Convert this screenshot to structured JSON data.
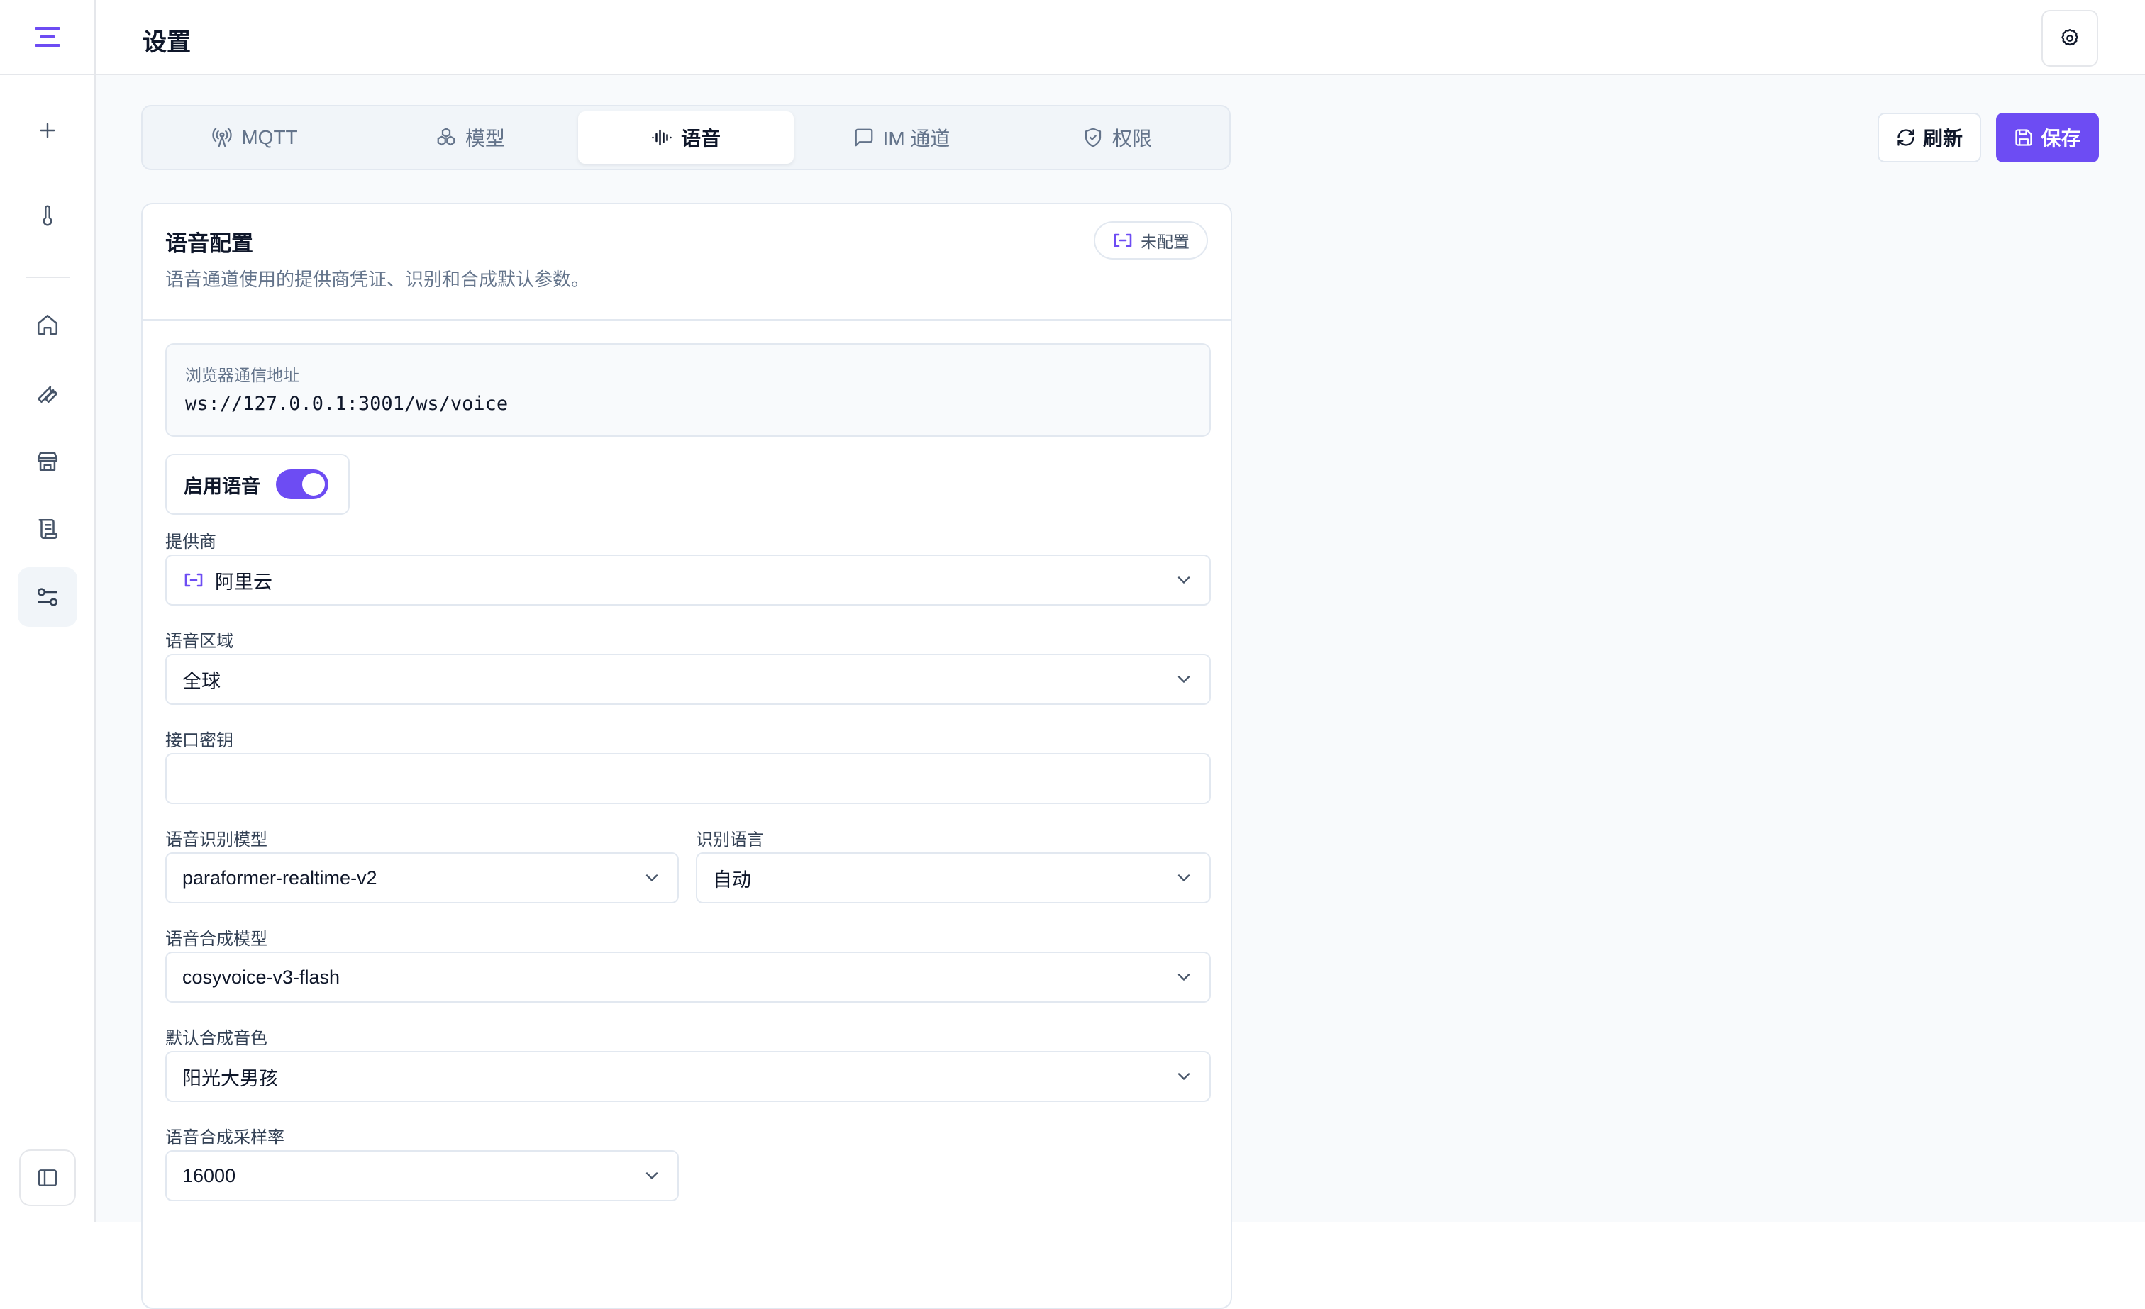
{
  "header": {
    "title": "设置"
  },
  "tabs": [
    {
      "label": "MQTT",
      "icon": "radio-tower-icon"
    },
    {
      "label": "模型",
      "icon": "boxes-icon"
    },
    {
      "label": "语音",
      "icon": "audio-waveform-icon",
      "active": true
    },
    {
      "label": "IM 通道",
      "icon": "message-square-icon"
    },
    {
      "label": "权限",
      "icon": "shield-check-icon"
    }
  ],
  "actions": {
    "refresh": "刷新",
    "save": "保存"
  },
  "card": {
    "title": "语音配置",
    "description": "语音通道使用的提供商凭证、识别和合成默认参数。",
    "status": "未配置"
  },
  "browser_url": {
    "label": "浏览器通信地址",
    "value": "ws://127.0.0.1:3001/ws/voice"
  },
  "enable_voice": {
    "label": "启用语音",
    "on": true
  },
  "fields": {
    "provider": {
      "label": "提供商",
      "value": "阿里云"
    },
    "region": {
      "label": "语音区域",
      "value": "全球"
    },
    "api_key": {
      "label": "接口密钥",
      "value": ""
    },
    "asr_model": {
      "label": "语音识别模型",
      "value": "paraformer-realtime-v2"
    },
    "asr_lang": {
      "label": "识别语言",
      "value": "自动"
    },
    "tts_model": {
      "label": "语音合成模型",
      "value": "cosyvoice-v3-flash"
    },
    "tts_voice": {
      "label": "默认合成音色",
      "value": "阳光大男孩"
    },
    "tts_rate": {
      "label": "语音合成采样率",
      "value": "16000"
    }
  },
  "colors": {
    "accent": "#6d4cf3",
    "border": "#e2e8f0",
    "muted": "#64748b"
  }
}
